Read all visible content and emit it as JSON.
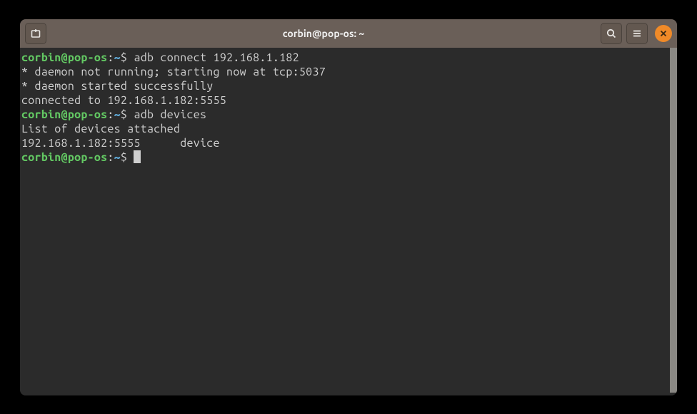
{
  "window": {
    "title": "corbin@pop-os: ~"
  },
  "prompt": {
    "user_host": "corbin@pop-os",
    "separator": ":",
    "path": "~",
    "symbol": "$"
  },
  "lines": {
    "cmd1": " adb connect 192.168.1.182",
    "out1": "* daemon not running; starting now at tcp:5037",
    "out2": "* daemon started successfully",
    "out3": "connected to 192.168.1.182:5555",
    "cmd2": " adb devices",
    "out4": "List of devices attached",
    "out5": "192.168.1.182:5555      device",
    "blank": "",
    "cmd3_space": " "
  },
  "icons": {
    "new_tab": "new-tab",
    "search": "search",
    "menu": "menu",
    "close": "close"
  }
}
